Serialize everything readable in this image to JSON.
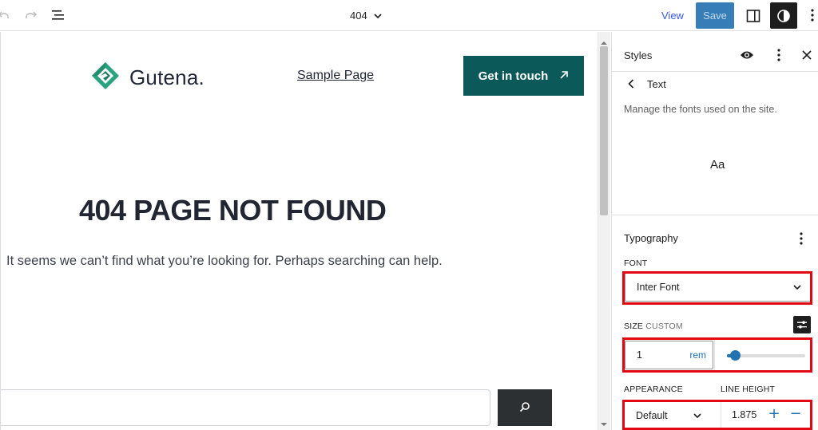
{
  "topbar": {
    "doc_title": "404",
    "view_label": "View",
    "save_label": "Save"
  },
  "canvas": {
    "logo_text": "Gutena.",
    "nav_link": "Sample Page",
    "cta_label": "Get in touch",
    "heading": "404 PAGE NOT FOUND",
    "body_text": "It seems we can’t find what you’re looking for. Perhaps searching can help.",
    "search_placeholder": ""
  },
  "sidebar": {
    "title": "Styles",
    "back_label": "Text",
    "description": "Manage the fonts used on the site.",
    "preview_text": "Aa",
    "typography_title": "Typography",
    "font_label": "FONT",
    "font_value": "Inter Font",
    "size_label": "SIZE",
    "size_mode": "CUSTOM",
    "size_value": "1",
    "size_unit": "rem",
    "size_slider_fraction": 0.1,
    "appearance_label": "APPEARANCE",
    "appearance_value": "Default",
    "line_height_label": "LINE HEIGHT",
    "line_height_value": "1.875"
  },
  "colors": {
    "accent": "#2271b1",
    "brand_button": "#0b5959",
    "logo_green": "#27a37f",
    "highlight": "#e30613"
  },
  "icons": {
    "undo": "undo-icon",
    "redo": "redo-icon",
    "document_overview": "list-view-icon",
    "chevron": "chevron-down-icon",
    "sidebar": "sidebar-toggle-icon",
    "styles": "contrast-icon",
    "more": "more-vertical-icon",
    "eye": "eye-icon",
    "close": "close-icon",
    "back": "chevron-left-icon",
    "arrow": "arrow-up-right-icon",
    "search": "search-icon",
    "settings": "sliders-icon"
  }
}
